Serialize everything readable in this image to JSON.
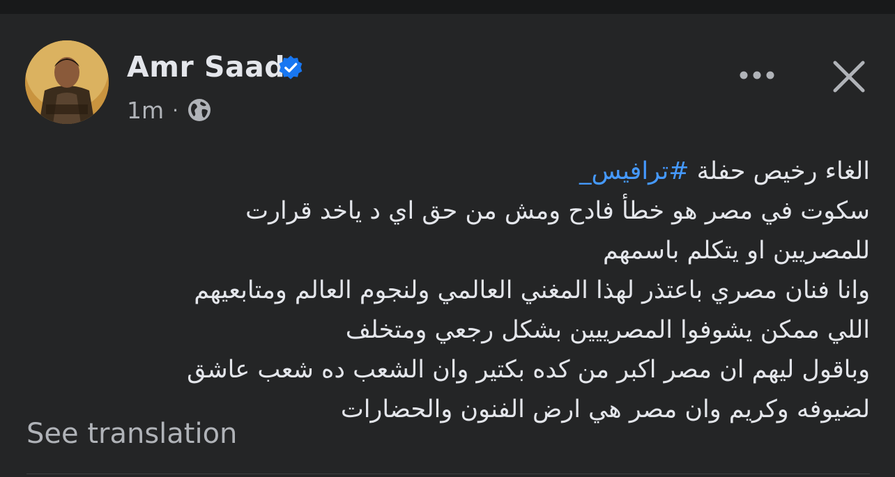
{
  "post": {
    "author_name": "Amr Saad",
    "timestamp": "1m",
    "separator": "·",
    "privacy_icon": "globe-icon",
    "verified_icon": "verified-badge-icon",
    "more_icon": "more-horizontal-icon",
    "close_icon": "close-icon",
    "hashtag": "#ترافيس_",
    "lines": [
      "الغاء رخيص حفلة",
      "سكوت في مصر هو خطأ فادح ومش من حق اي د ياخد قرارت",
      "للمصريين او يتكلم باسمهم",
      "وانا فنان مصري باعتذر لهذا المغني العالمي ولنجوم العالم ومتابعيهم",
      "اللي ممكن يشوفوا المصرييين بشكل رجعي ومتخلف",
      "وباقول ليهم ان مصر اكبر من كده بكتير وان الشعب ده شعب عاشق",
      "لضيوفه وكريم وان مصر هي ارض الفنون والحضارات"
    ],
    "see_translation": "See translation"
  },
  "colors": {
    "background": "#242526",
    "text_primary": "#e4e6eb",
    "text_secondary": "#b0b3b8",
    "hashtag": "#4599ff",
    "verified": "#1877f2"
  }
}
